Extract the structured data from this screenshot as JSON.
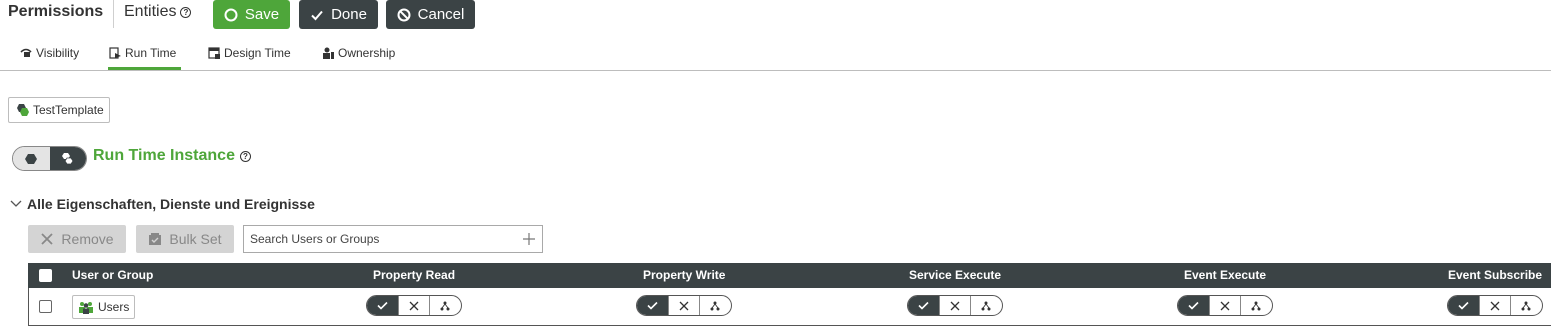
{
  "header": {
    "title": "Permissions",
    "subtitle": "Entities",
    "help_symbol": "?",
    "save_label": "Save",
    "done_label": "Done",
    "cancel_label": "Cancel"
  },
  "tabs": [
    {
      "label": "Visibility",
      "active": false
    },
    {
      "label": "Run Time",
      "active": true
    },
    {
      "label": "Design Time",
      "active": false
    },
    {
      "label": "Ownership",
      "active": false
    }
  ],
  "template_chip": {
    "label": "TestTemplate"
  },
  "instance": {
    "title": "Run Time Instance",
    "help_symbol": "?"
  },
  "section": {
    "title": "Alle Eigenschaften, Dienste und Ereignisse",
    "expanded": true
  },
  "toolbar": {
    "remove_label": "Remove",
    "bulk_set_label": "Bulk Set",
    "search_placeholder": "Search Users or Groups",
    "search_value": ""
  },
  "table": {
    "columns": [
      "User or Group",
      "Property Read",
      "Property Write",
      "Service Execute",
      "Event Execute",
      "Event Subscribe"
    ],
    "rows": [
      {
        "name": "Users",
        "checked": false,
        "permissions": [
          "inherit-allow",
          "inherit-allow",
          "inherit-allow",
          "inherit-allow",
          "inherit-allow"
        ]
      }
    ]
  },
  "colors": {
    "accent_green": "#4ea63a",
    "dark": "#3b4345",
    "disabled": "#d4d4d4"
  },
  "icons": [
    "check-circle-icon",
    "check-icon",
    "cancel-icon",
    "visibility-icon",
    "run-time-icon",
    "design-time-icon",
    "ownership-icon",
    "template-icon",
    "help-icon",
    "chevron-down-icon",
    "remove-icon",
    "bulk-set-icon",
    "add-icon",
    "users-icon",
    "allow-icon",
    "deny-icon",
    "inherit-icon"
  ]
}
